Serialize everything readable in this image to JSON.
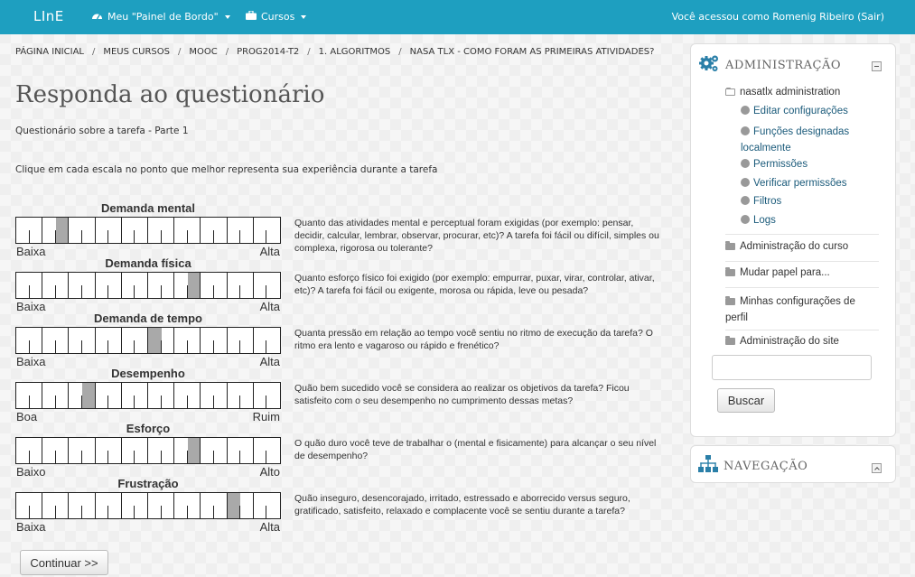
{
  "navbar": {
    "brand": "LInE",
    "menu_dashboard": "Meu \"Painel de Bordo\"",
    "menu_courses": "Cursos",
    "user_text": "Você acessou como Romenig Ribeiro",
    "logout": "(Sair)",
    "accent_color": "#1e9fc0"
  },
  "breadcrumb": [
    "PÁGINA INICIAL",
    "MEUS CURSOS",
    "MOOC",
    "PROG2014-T2",
    "1. ALGORITMOS",
    "NASA TLX - COMO FORAM AS PRIMEIRAS ATIVIDADES?"
  ],
  "page": {
    "title": "Responda ao questionário",
    "subtitle": "Questionário sobre a tarefa - Parte 1",
    "instruction": "Clique em cada escala no ponto que melhor representa sua experiência durante a tarefa"
  },
  "scales": [
    {
      "title": "Demanda mental",
      "low": "Baixa",
      "high": "Alta",
      "selected_segment": 3,
      "description": "Quanto das atividades mental e perceptual foram exigidas (por exemplo: pensar, decidir, calcular, lembrar, observar, procurar, etc)? A tarefa foi fácil ou difícil, simples ou complexa, rigorosa ou tolerante?"
    },
    {
      "title": "Demanda física",
      "low": "Baixa",
      "high": "Alta",
      "selected_segment": 13,
      "description": "Quanto esforço físico foi exigido (por exemplo: empurrar, puxar, virar, controlar, ativar, etc)? A tarefa foi fácil ou exigente, morosa ou rápida, leve ou pesada?"
    },
    {
      "title": "Demanda de tempo",
      "low": "Baixa",
      "high": "Alta",
      "selected_segment": 10,
      "description": "Quanta pressão em relação ao tempo você sentiu no ritmo de execução da tarefa? O ritmo era lento e vagaroso ou rápido e frenético?"
    },
    {
      "title": "Desempenho",
      "low": "Boa",
      "high": "Ruim",
      "selected_segment": 5,
      "description": "Quão bem sucedido você se considera ao realizar os objetivos da tarefa? Ficou satisfeito com o seu desempenho no cumprimento dessas metas?"
    },
    {
      "title": "Esforço",
      "low": "Baixo",
      "high": "Alto",
      "selected_segment": 13,
      "description": "O quão duro você teve de trabalhar o (mental e fisicamente) para alcançar o seu nível de desempenho?"
    },
    {
      "title": "Frustração",
      "low": "Baixa",
      "high": "Alta",
      "selected_segment": 16,
      "description": "Quão inseguro, desencorajado, irritado, estressado e aborrecido versus seguro, gratificado, satisfeito, relaxado e complacente você se sentiu durante a tarefa?"
    }
  ],
  "continue_label": "Continuar >>",
  "admin_block": {
    "title": "ADMINISTRAÇÃO",
    "root": "nasatlx administration",
    "links": [
      "Editar configurações",
      "Funções designadas localmente",
      "Permissões",
      "Verificar permissões",
      "Filtros",
      "Logs"
    ],
    "sections": [
      "Administração do curso",
      "Mudar papel para...",
      "Minhas configurações de perfil",
      "Administração do site"
    ],
    "search_button": "Buscar"
  },
  "nav_block": {
    "title": "NAVEGAÇÃO"
  }
}
